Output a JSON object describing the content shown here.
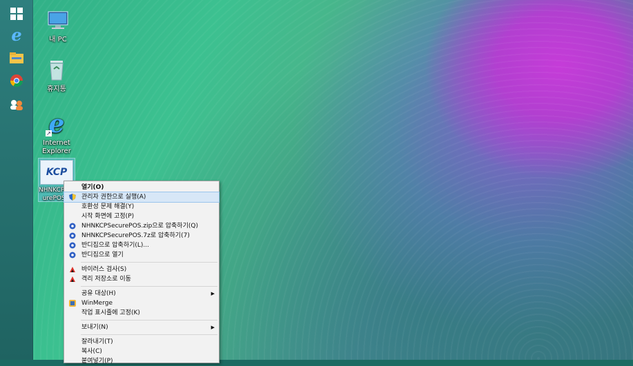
{
  "desktop": {
    "icons": [
      {
        "label": "내 PC"
      },
      {
        "label": "휴지통"
      },
      {
        "label": "Internet Explorer"
      },
      {
        "label_line1": "NHNKCPSec",
        "label_line2": "urePOS.z",
        "logo_text": "KCP"
      }
    ]
  },
  "taskbar": {
    "icons": [
      "windows-start-icon",
      "internet-explorer-icon",
      "file-explorer-icon",
      "chrome-icon",
      "people-icon"
    ]
  },
  "context_menu": {
    "open": "열기(O)",
    "run_as_admin": "관리자 권한으로 실행(A)",
    "troubleshoot": "호환성 문제 해결(Y)",
    "pin_start": "시작 화면에 고정(P)",
    "zip": "NHNKCPSecurePOS.zip으로 압축하기(Q)",
    "sevenz": "NHNKCPSecurePOS.7z로 압축하기(7)",
    "bandizip_compress": "반디집으로 압축하기(L)...",
    "bandizip_open": "반디집으로 열기",
    "virus_scan": "바이러스 검사(S)",
    "quarantine": "격리 저장소로 이동",
    "share": "공유 대상(H)",
    "winmerge": "WinMerge",
    "pin_taskbar": "작업 표시줄에 고정(K)",
    "send_to": "보내기(N)",
    "cut": "잘라내기(T)",
    "copy": "복사(C)",
    "paste": "붙여넣기(P)"
  }
}
